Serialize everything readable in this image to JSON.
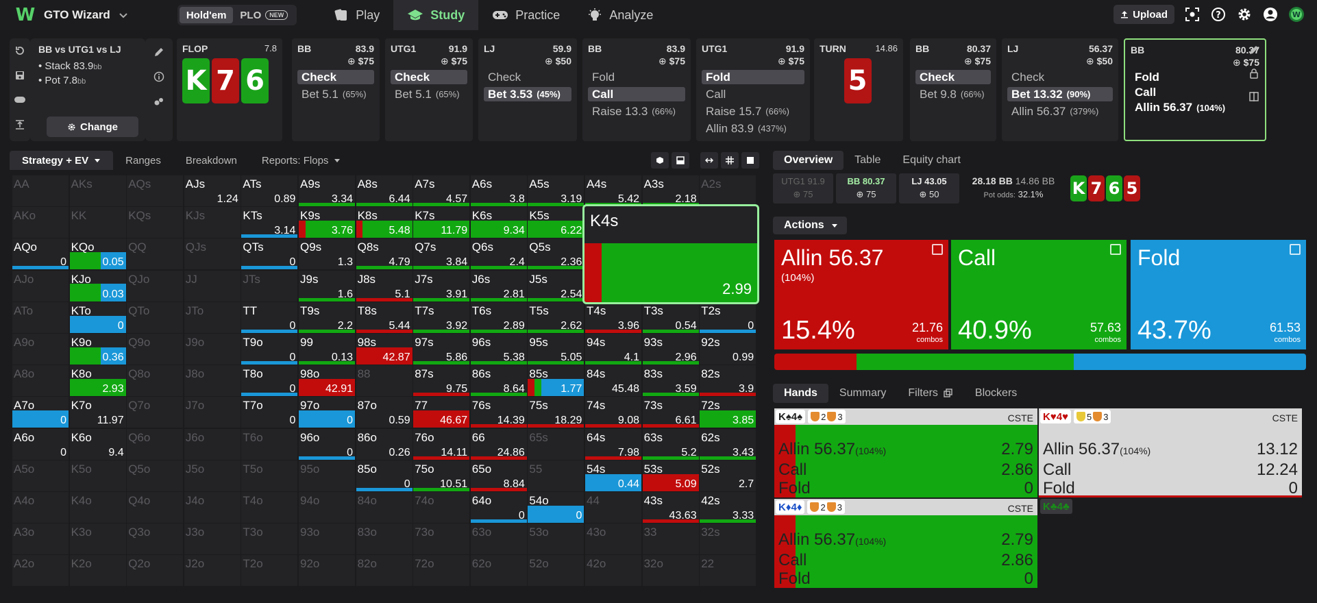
{
  "topbar": {
    "brand": "GTO Wizard",
    "variants": [
      "Hold'em",
      "PLO"
    ],
    "variant_selected": "Hold'em",
    "new_badge": "NEW",
    "nav": [
      {
        "label": "Play",
        "icon": "spade-card-icon"
      },
      {
        "label": "Study",
        "icon": "graduation-cap-icon",
        "selected": true
      },
      {
        "label": "Practice",
        "icon": "gamepad-icon"
      },
      {
        "label": "Analyze",
        "icon": "lightbulb-icon"
      }
    ],
    "upload": "Upload"
  },
  "spot": {
    "title": "BB vs UTG1 vs LJ",
    "stack_label": "Stack 83.9",
    "stack_unit": "bb",
    "pot_label": "Pot 7.8",
    "pot_unit": "bb",
    "change": "Change"
  },
  "columns": [
    {
      "name": "FLOP",
      "value": "7.8",
      "type": "street",
      "cards": [
        {
          "r": "K",
          "c": "g"
        },
        {
          "r": "7",
          "c": "r"
        },
        {
          "r": "6",
          "c": "g"
        }
      ]
    },
    {
      "name": "BB",
      "value": "83.9",
      "chip": "$75",
      "actions": [
        {
          "t": "Check",
          "sel": true
        },
        {
          "t": "Bet 5.1",
          "p": "(65%)"
        }
      ]
    },
    {
      "name": "UTG1",
      "value": "91.9",
      "chip": "$75",
      "actions": [
        {
          "t": "Check",
          "sel": true
        },
        {
          "t": "Bet 5.1",
          "p": "(65%)"
        }
      ]
    },
    {
      "name": "LJ",
      "value": "59.9",
      "chip": "$50",
      "actions": [
        {
          "t": "Check"
        },
        {
          "t": "Bet 3.53",
          "p": "(45%)",
          "sel": true
        }
      ]
    },
    {
      "name": "BB",
      "value": "83.9",
      "chip": "$75",
      "actions": [
        {
          "t": "Fold"
        },
        {
          "t": "Call",
          "sel": true
        },
        {
          "t": "Raise 13.3",
          "p": "(66%)"
        }
      ]
    },
    {
      "name": "UTG1",
      "value": "91.9",
      "chip": "$75",
      "actions": [
        {
          "t": "Fold",
          "sel": true
        },
        {
          "t": "Call"
        },
        {
          "t": "Raise 15.7",
          "p": "(66%)"
        },
        {
          "t": "Allin 83.9",
          "p": "(437%)"
        }
      ]
    },
    {
      "name": "TURN",
      "value": "14.86",
      "type": "street",
      "cards": [
        {
          "r": "5",
          "c": "r"
        }
      ]
    },
    {
      "name": "BB",
      "value": "80.37",
      "chip": "$75",
      "actions": [
        {
          "t": "Check",
          "sel": true
        },
        {
          "t": "Bet 9.8",
          "p": "(66%)"
        }
      ]
    },
    {
      "name": "LJ",
      "value": "56.37",
      "chip": "$50",
      "actions": [
        {
          "t": "Check"
        },
        {
          "t": "Bet 13.32",
          "p": "(90%)",
          "sel": true
        },
        {
          "t": "Allin 56.37",
          "p": "(379%)"
        }
      ]
    },
    {
      "name": "BB",
      "value": "80.37",
      "chip": "$75",
      "active": true,
      "actions": [
        {
          "t": "Fold"
        },
        {
          "t": "Call"
        },
        {
          "t": "Allin 56.37",
          "p": "(104%)"
        }
      ]
    }
  ],
  "grid_tabs": [
    "Strategy + EV",
    "Ranges",
    "Breakdown",
    "Reports: Flops"
  ],
  "grid": [
    [
      [
        "AA",
        "",
        "d"
      ],
      [
        "AKs",
        "",
        "d"
      ],
      [
        "AQs",
        "",
        "d"
      ],
      [
        "AJs",
        "1.24",
        ""
      ],
      [
        "ATs",
        "0.89",
        ""
      ],
      [
        "A9s",
        "3.34",
        "ug"
      ],
      [
        "A8s",
        "6.44",
        "ug"
      ],
      [
        "A7s",
        "4.57",
        "ug"
      ],
      [
        "A6s",
        "3.8",
        "ug"
      ],
      [
        "A5s",
        "3.19",
        "ug"
      ],
      [
        "A4s",
        "5.42",
        "ug"
      ],
      [
        "A3s",
        "2.18",
        "ug"
      ],
      [
        "A2s",
        "",
        "d"
      ]
    ],
    [
      [
        "AKo",
        "",
        "d"
      ],
      [
        "KK",
        "",
        "d"
      ],
      [
        "KQs",
        "",
        "d"
      ],
      [
        "KJs",
        "",
        "d"
      ],
      [
        "KTs",
        "3.14",
        "ub"
      ],
      [
        "K9s",
        "3.76",
        "rg"
      ],
      [
        "K8s",
        "5.48",
        "rg"
      ],
      [
        "K7s",
        "11.79",
        "g"
      ],
      [
        "K6s",
        "9.34",
        "g"
      ],
      [
        "K5s",
        "6.22",
        "g"
      ],
      [
        "K4s",
        "2.99",
        "rg"
      ],
      [
        "K3s",
        "",
        "d"
      ],
      [
        "K2s",
        "",
        "d"
      ]
    ],
    [
      [
        "AQo",
        "0",
        "ub"
      ],
      [
        "KQo",
        "0.05",
        "gb"
      ],
      [
        "QQ",
        "",
        "d"
      ],
      [
        "QJs",
        "",
        "d"
      ],
      [
        "QTs",
        "0",
        "ub"
      ],
      [
        "Q9s",
        "1.3",
        ""
      ],
      [
        "Q8s",
        "4.79",
        "ug"
      ],
      [
        "Q7s",
        "3.84",
        "ug"
      ],
      [
        "Q6s",
        "2.4",
        "ug"
      ],
      [
        "Q5s",
        "2.36",
        "ug"
      ],
      [
        "Q4s",
        "",
        "d"
      ],
      [
        "Q3s",
        "",
        "d"
      ],
      [
        "Q2s",
        "",
        "d"
      ]
    ],
    [
      [
        "AJo",
        "",
        "d"
      ],
      [
        "KJo",
        "0.03",
        "gb"
      ],
      [
        "QJo",
        "",
        "d"
      ],
      [
        "JJ",
        "",
        "d"
      ],
      [
        "JTs",
        "",
        "d"
      ],
      [
        "J9s",
        "1.6",
        "ug"
      ],
      [
        "J8s",
        "5.1",
        "ur"
      ],
      [
        "J7s",
        "3.91",
        "ug"
      ],
      [
        "J6s",
        "2.81",
        "ug"
      ],
      [
        "J5s",
        "2.54",
        "ug"
      ],
      [
        "J4s",
        "",
        "d"
      ],
      [
        "J3s",
        "",
        "d"
      ],
      [
        "J2s",
        "",
        "d"
      ]
    ],
    [
      [
        "ATo",
        "",
        "d"
      ],
      [
        "KTo",
        "0",
        "b"
      ],
      [
        "QTo",
        "",
        "d"
      ],
      [
        "JTo",
        "",
        "d"
      ],
      [
        "TT",
        "0",
        "ub"
      ],
      [
        "T9s",
        "2.2",
        "ug"
      ],
      [
        "T8s",
        "5.44",
        "ur"
      ],
      [
        "T7s",
        "3.92",
        "ug"
      ],
      [
        "T6s",
        "2.89",
        "ug"
      ],
      [
        "T5s",
        "2.62",
        "ug"
      ],
      [
        "T4s",
        "3.96",
        "ur"
      ],
      [
        "T3s",
        "0.54",
        "ug"
      ],
      [
        "T2s",
        "0",
        "ub"
      ]
    ],
    [
      [
        "A9o",
        "",
        "d"
      ],
      [
        "K9o",
        "0.36",
        "gb"
      ],
      [
        "Q9o",
        "",
        "d"
      ],
      [
        "J9o",
        "",
        "d"
      ],
      [
        "T9o",
        "0",
        "ub"
      ],
      [
        "99",
        "0.13",
        "ug"
      ],
      [
        "98s",
        "42.87",
        "r"
      ],
      [
        "97s",
        "5.86",
        "ug"
      ],
      [
        "96s",
        "5.38",
        "ug"
      ],
      [
        "95s",
        "5.05",
        "ug"
      ],
      [
        "94s",
        "4.1",
        "ug"
      ],
      [
        "93s",
        "2.96",
        "ug"
      ],
      [
        "92s",
        "0.99",
        ""
      ]
    ],
    [
      [
        "A8o",
        "",
        "d"
      ],
      [
        "K8o",
        "2.93",
        "g"
      ],
      [
        "Q8o",
        "",
        "d"
      ],
      [
        "J8o",
        "",
        "d"
      ],
      [
        "T8o",
        "0",
        "ub"
      ],
      [
        "98o",
        "42.91",
        "r"
      ],
      [
        "88",
        "",
        "d"
      ],
      [
        "87s",
        "9.75",
        "ur"
      ],
      [
        "86s",
        "8.64",
        "ug"
      ],
      [
        "85s",
        "1.77",
        "rgb"
      ],
      [
        "84s",
        "45.48",
        ""
      ],
      [
        "83s",
        "3.59",
        "ug"
      ],
      [
        "82s",
        "3.9",
        "ur"
      ]
    ],
    [
      [
        "A7o",
        "0",
        "b"
      ],
      [
        "K7o",
        "11.97",
        ""
      ],
      [
        "Q7o",
        "",
        "d"
      ],
      [
        "J7o",
        "",
        "d"
      ],
      [
        "T7o",
        "0",
        ""
      ],
      [
        "97o",
        "0",
        "b"
      ],
      [
        "87o",
        "0.59",
        ""
      ],
      [
        "77",
        "46.67",
        "r"
      ],
      [
        "76s",
        "14.39",
        "ur"
      ],
      [
        "75s",
        "18.29",
        "ur"
      ],
      [
        "74s",
        "9.08",
        "ur"
      ],
      [
        "73s",
        "6.61",
        "ur"
      ],
      [
        "72s",
        "3.85",
        "g"
      ]
    ],
    [
      [
        "A6o",
        "0",
        ""
      ],
      [
        "K6o",
        "9.4",
        ""
      ],
      [
        "Q6o",
        "",
        "d"
      ],
      [
        "J6o",
        "",
        "d"
      ],
      [
        "T6o",
        "",
        "d"
      ],
      [
        "96o",
        "0",
        "ub"
      ],
      [
        "86o",
        "0.26",
        ""
      ],
      [
        "76o",
        "14.11",
        "ur"
      ],
      [
        "66",
        "24.86",
        "ur"
      ],
      [
        "65s",
        "",
        "d"
      ],
      [
        "64s",
        "7.98",
        "ur"
      ],
      [
        "63s",
        "5.2",
        "ug"
      ],
      [
        "62s",
        "3.43",
        "ug"
      ]
    ],
    [
      [
        "A5o",
        "",
        "d"
      ],
      [
        "K5o",
        "",
        "d"
      ],
      [
        "Q5o",
        "",
        "d"
      ],
      [
        "J5o",
        "",
        "d"
      ],
      [
        "T5o",
        "",
        "d"
      ],
      [
        "95o",
        "",
        "d"
      ],
      [
        "85o",
        "0",
        "ub"
      ],
      [
        "75o",
        "10.51",
        "ug"
      ],
      [
        "65o",
        "8.84",
        "ur"
      ],
      [
        "55",
        "",
        "d"
      ],
      [
        "54s",
        "0.44",
        "b"
      ],
      [
        "53s",
        "5.09",
        "r"
      ],
      [
        "52s",
        "2.7",
        ""
      ]
    ],
    [
      [
        "A4o",
        "",
        "d"
      ],
      [
        "K4o",
        "",
        "d"
      ],
      [
        "Q4o",
        "",
        "d"
      ],
      [
        "J4o",
        "",
        "d"
      ],
      [
        "T4o",
        "",
        "d"
      ],
      [
        "94o",
        "",
        "d"
      ],
      [
        "84o",
        "",
        "d"
      ],
      [
        "74o",
        "",
        "d"
      ],
      [
        "64o",
        "0",
        "ub"
      ],
      [
        "54o",
        "0",
        "b"
      ],
      [
        "44",
        "",
        "d"
      ],
      [
        "43s",
        "43.63",
        "ur"
      ],
      [
        "42s",
        "3.33",
        "ug"
      ]
    ],
    [
      [
        "A3o",
        "",
        "d"
      ],
      [
        "K3o",
        "",
        "d"
      ],
      [
        "Q3o",
        "",
        "d"
      ],
      [
        "J3o",
        "",
        "d"
      ],
      [
        "T3o",
        "",
        "d"
      ],
      [
        "93o",
        "",
        "d"
      ],
      [
        "83o",
        "",
        "d"
      ],
      [
        "73o",
        "",
        "d"
      ],
      [
        "63o",
        "",
        "d"
      ],
      [
        "53o",
        "",
        "d"
      ],
      [
        "43o",
        "",
        "d"
      ],
      [
        "33",
        "",
        "d"
      ],
      [
        "32s",
        "",
        "d"
      ]
    ],
    [
      [
        "A2o",
        "",
        "d"
      ],
      [
        "K2o",
        "",
        "d"
      ],
      [
        "Q2o",
        "",
        "d"
      ],
      [
        "J2o",
        "",
        "d"
      ],
      [
        "T2o",
        "",
        "d"
      ],
      [
        "92o",
        "",
        "d"
      ],
      [
        "82o",
        "",
        "d"
      ],
      [
        "72o",
        "",
        "d"
      ],
      [
        "62o",
        "",
        "d"
      ],
      [
        "52o",
        "",
        "d"
      ],
      [
        "42o",
        "",
        "d"
      ],
      [
        "32o",
        "",
        "d"
      ],
      [
        "22",
        "",
        "d"
      ]
    ]
  ],
  "zoom": {
    "label": "K4s",
    "value": "2.99",
    "allin": 0.1,
    "call": 0.9
  },
  "right_tabs": [
    "Overview",
    "Table",
    "Equity chart"
  ],
  "overview": {
    "p1_name": "UTG1 91.9",
    "p1_chip": "75",
    "p2_name": "BB 80.37",
    "p2_chip": "75",
    "p3_name": "LJ 43.05",
    "p3_chip": "50",
    "pot_bb": "28.18 BB",
    "pot_total": "14.86 BB",
    "odds_label": "Pot odds:",
    "odds_value": "32.1%",
    "board": [
      {
        "r": "K",
        "c": "g"
      },
      {
        "r": "7",
        "c": "r"
      },
      {
        "r": "6",
        "c": "g"
      },
      {
        "r": "5",
        "c": "r"
      }
    ]
  },
  "actions_label": "Actions",
  "actions": [
    {
      "name": "Allin 56.37",
      "sub": "(104%)",
      "pct": "15.4%",
      "combos": "21.76",
      "combos_label": "combos",
      "color": "#c20c0c",
      "frac": 0.154
    },
    {
      "name": "Call",
      "sub": "",
      "pct": "40.9%",
      "combos": "57.63",
      "combos_label": "combos",
      "color": "#12a812",
      "frac": 0.409
    },
    {
      "name": "Fold",
      "sub": "",
      "pct": "43.7%",
      "combos": "61.53",
      "combos_label": "combos",
      "color": "#1a97d8",
      "frac": 0.437
    }
  ],
  "hand_tabs": [
    "Hands",
    "Summary",
    "Filters",
    "Blockers"
  ],
  "hands": [
    {
      "cards": "K♠4♠",
      "card_color": "#222",
      "b1": "2",
      "b2": "3",
      "b1c": "#e48b2f",
      "b2c": "#e48b2f",
      "tag": "CSTE",
      "allin": "Allin 56.37",
      "allin_p": "(104%)",
      "allin_v": "2.79",
      "call": "Call",
      "call_v": "2.86",
      "fold": "Fold",
      "fold_v": "0",
      "bg": "#12a812",
      "red": 0.1
    },
    {
      "cards": "K♥4♥",
      "card_color": "#c20c0c",
      "b1": "5",
      "b2": "3",
      "b1c": "#e8c93a",
      "b2c": "#e48b2f",
      "tag": "CSTE",
      "allin": "Allin 56.37",
      "allin_p": "(104%)",
      "allin_v": "13.12",
      "call": "Call",
      "call_v": "12.24",
      "fold": "Fold",
      "fold_v": "0",
      "bg": "#d7d7d7",
      "red": 0
    },
    {
      "cards": "K♦4♦",
      "card_color": "#1a50c8",
      "b1": "2",
      "b2": "3",
      "b1c": "#e48b2f",
      "b2c": "#e48b2f",
      "tag": "CSTE",
      "allin": "Allin 56.37",
      "allin_p": "(104%)",
      "allin_v": "2.79",
      "call": "Call",
      "call_v": "2.86",
      "fold": "Fold",
      "fold_v": "0",
      "bg": "#12a812",
      "red": 0.1
    }
  ],
  "hand4": "K♣4♣"
}
